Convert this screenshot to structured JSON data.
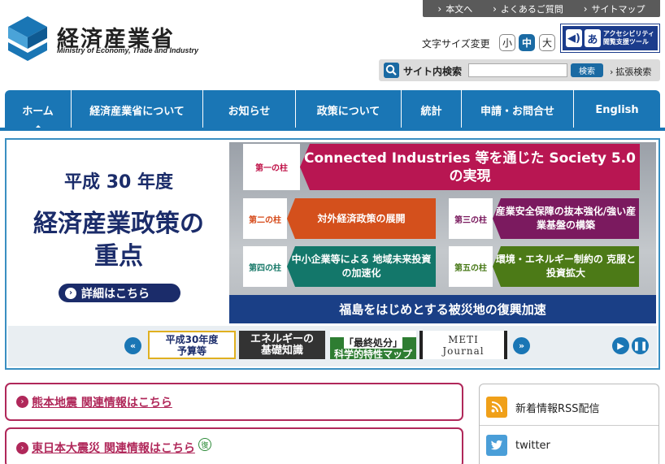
{
  "header": {
    "logo_ja": "経済産業省",
    "logo_en": "Ministry of Economy, Trade and Industry",
    "top_links": [
      "本文へ",
      "よくあるご質問",
      "サイトマップ"
    ],
    "font_size_label": "文字サイズ変更",
    "font_sizes": [
      "小",
      "中",
      "大"
    ],
    "accessibility_line1": "アクセシビリティ",
    "accessibility_line2": "閲覧支援ツール",
    "search_label": "サイト内検索",
    "search_value": "",
    "search_button": "検索",
    "advanced_search": "拡張検索"
  },
  "nav": [
    "ホーム",
    "経済産業省について",
    "お知らせ",
    "政策について",
    "統計",
    "申請・お問合せ",
    "English"
  ],
  "banner": {
    "subtitle": "平成 30 年度",
    "title_line1": "経済産業政策の",
    "title_line2": "重点",
    "detail_button": "詳細はこちら",
    "pillars": [
      {
        "tag": "第一の柱",
        "text": "Connected Industries 等を通じた Society 5.0の実現"
      },
      {
        "tag": "第二の柱",
        "text": "対外経済政策の展開"
      },
      {
        "tag": "第三の柱",
        "text": "産業安全保障の抜本強化/強い産業基盤の構築"
      },
      {
        "tag": "第四の柱",
        "text": "中小企業等による 地域未来投資の加速化"
      },
      {
        "tag": "第五の柱",
        "text": "環境・エネルギー制約の 克服と投資拡大"
      }
    ],
    "bottom_text": "福島をはじめとする被災地の復興加速"
  },
  "carousel": {
    "thumbs": [
      {
        "line1": "平成30年度",
        "line2": "予算等"
      },
      {
        "line1": "エネルギーの",
        "line2": "基礎知識"
      },
      {
        "line1": "「最終処分」",
        "line2": "科学的特性マップ"
      },
      {
        "line1": "METI",
        "line2": "Journal"
      }
    ]
  },
  "alerts": [
    {
      "text": "熊本地震 関連情報はこちら"
    },
    {
      "text": "東日本大震災 関連情報はこちら",
      "badge": "復"
    }
  ],
  "sidebar": {
    "rss": "新着情報RSS配信",
    "twitter": "twitter"
  }
}
